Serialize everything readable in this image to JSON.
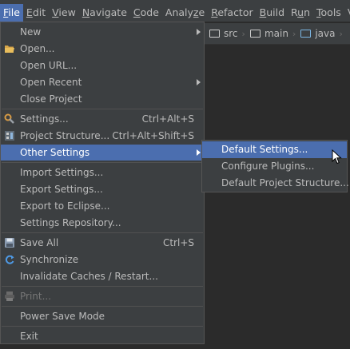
{
  "menubar": {
    "items": [
      "File",
      "Edit",
      "View",
      "Navigate",
      "Code",
      "Analyze",
      "Refactor",
      "Build",
      "Run",
      "Tools",
      "V"
    ],
    "mnemonics": [
      "F",
      "E",
      "V",
      "N",
      "C",
      "z",
      "R",
      "B",
      "u",
      "T",
      ""
    ]
  },
  "breadcrumb": {
    "items": [
      {
        "label": "src",
        "icon": "folder-icon"
      },
      {
        "label": "main",
        "icon": "folder-icon"
      },
      {
        "label": "java",
        "icon": "source-folder-icon"
      }
    ]
  },
  "file_menu": {
    "new": {
      "label": "New"
    },
    "open": {
      "label": "Open...",
      "icon": "folder-open-icon"
    },
    "open_url": {
      "label": "Open URL..."
    },
    "open_recent": {
      "label": "Open Recent"
    },
    "close_project": {
      "label": "Close Project"
    },
    "settings": {
      "label": "Settings...",
      "shortcut": "Ctrl+Alt+S",
      "icon": "wrench-icon"
    },
    "project_structure": {
      "label": "Project Structure...",
      "shortcut": "Ctrl+Alt+Shift+S",
      "icon": "project-structure-icon"
    },
    "other_settings": {
      "label": "Other Settings"
    },
    "import_settings": {
      "label": "Import Settings..."
    },
    "export_settings": {
      "label": "Export Settings..."
    },
    "export_eclipse": {
      "label": "Export to Eclipse..."
    },
    "settings_repo": {
      "label": "Settings Repository..."
    },
    "save_all": {
      "label": "Save All",
      "shortcut": "Ctrl+S",
      "icon": "save-icon"
    },
    "synchronize": {
      "label": "Synchronize",
      "icon": "sync-icon"
    },
    "invalidate": {
      "label": "Invalidate Caches / Restart..."
    },
    "print": {
      "label": "Print...",
      "icon": "print-icon"
    },
    "power_save": {
      "label": "Power Save Mode"
    },
    "exit": {
      "label": "Exit"
    }
  },
  "other_settings_menu": {
    "default_settings": {
      "label": "Default Settings..."
    },
    "configure_plugins": {
      "label": "Configure Plugins..."
    },
    "default_project_structure": {
      "label": "Default Project Structure..."
    }
  },
  "colors": {
    "background": "#2b2b2b",
    "menu_background": "#3c3f41",
    "selection": "#4b6eaf",
    "text": "#bbbbbb"
  }
}
